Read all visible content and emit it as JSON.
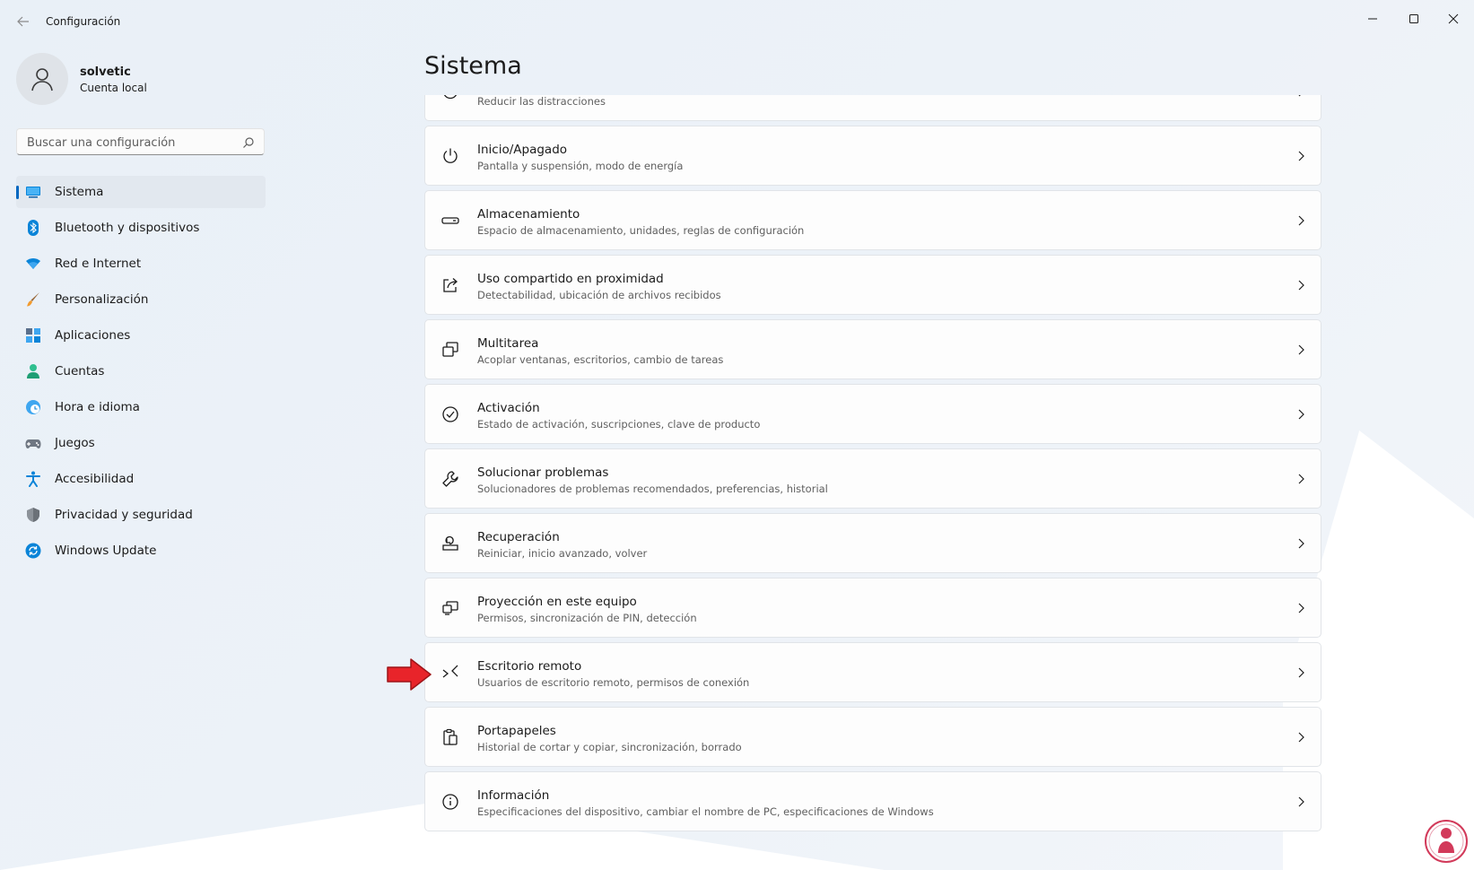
{
  "window": {
    "title": "Configuración"
  },
  "profile": {
    "name": "solvetic",
    "account_type": "Cuenta local"
  },
  "search": {
    "placeholder": "Buscar una configuración"
  },
  "sidebar": {
    "items": [
      {
        "label": "Sistema",
        "icon": "monitor-icon",
        "active": true
      },
      {
        "label": "Bluetooth y dispositivos",
        "icon": "bluetooth-icon"
      },
      {
        "label": "Red e Internet",
        "icon": "wifi-icon"
      },
      {
        "label": "Personalización",
        "icon": "brush-icon"
      },
      {
        "label": "Aplicaciones",
        "icon": "apps-icon"
      },
      {
        "label": "Cuentas",
        "icon": "person-icon"
      },
      {
        "label": "Hora e idioma",
        "icon": "globe-clock-icon"
      },
      {
        "label": "Juegos",
        "icon": "gamepad-icon"
      },
      {
        "label": "Accesibilidad",
        "icon": "accessibility-icon"
      },
      {
        "label": "Privacidad y seguridad",
        "icon": "shield-icon"
      },
      {
        "label": "Windows Update",
        "icon": "update-icon"
      }
    ]
  },
  "main": {
    "title": "Sistema",
    "items": [
      {
        "title": "",
        "subtitle": "Reducir las distracciones",
        "icon": "focus-icon"
      },
      {
        "title": "Inicio/Apagado",
        "subtitle": "Pantalla y suspensión, modo de energía",
        "icon": "power-icon"
      },
      {
        "title": "Almacenamiento",
        "subtitle": "Espacio de almacenamiento, unidades, reglas de configuración",
        "icon": "storage-icon"
      },
      {
        "title": "Uso compartido en proximidad",
        "subtitle": "Detectabilidad, ubicación de archivos recibidos",
        "icon": "share-icon"
      },
      {
        "title": "Multitarea",
        "subtitle": "Acoplar ventanas, escritorios, cambio de tareas",
        "icon": "multitask-icon"
      },
      {
        "title": "Activación",
        "subtitle": "Estado de activación, suscripciones, clave de producto",
        "icon": "check-circle-icon"
      },
      {
        "title": "Solucionar problemas",
        "subtitle": "Solucionadores de problemas recomendados, preferencias, historial",
        "icon": "wrench-icon"
      },
      {
        "title": "Recuperación",
        "subtitle": "Reiniciar, inicio avanzado, volver",
        "icon": "recovery-icon"
      },
      {
        "title": "Proyección en este equipo",
        "subtitle": "Permisos, sincronización de PIN, detección",
        "icon": "projection-icon"
      },
      {
        "title": "Escritorio remoto",
        "subtitle": "Usuarios de escritorio remoto, permisos de conexión",
        "icon": "remote-desktop-icon"
      },
      {
        "title": "Portapapeles",
        "subtitle": "Historial de cortar y copiar, sincronización, borrado",
        "icon": "clipboard-icon"
      },
      {
        "title": "Información",
        "subtitle": "Especificaciones del dispositivo, cambiar el nombre de PC, especificaciones de Windows",
        "icon": "info-icon"
      }
    ]
  },
  "colors": {
    "accent": "#0067c0",
    "annotation_arrow": "#e8242a"
  }
}
